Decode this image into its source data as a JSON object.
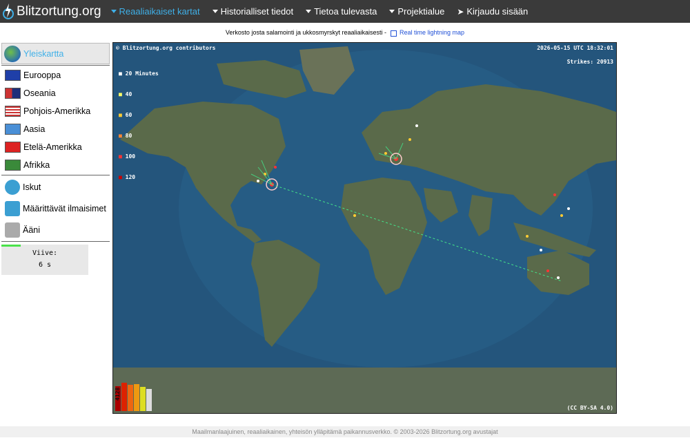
{
  "nav": {
    "brand": "Blitzortung.org",
    "items": [
      {
        "label": "Reaaliaikaiset kartat",
        "active": true,
        "icon": "caret-down"
      },
      {
        "label": "Historialliset tiedot",
        "active": false,
        "icon": "caret-down"
      },
      {
        "label": "Tietoa tulevasta",
        "active": false,
        "icon": "caret-down"
      },
      {
        "label": "Projektialue",
        "active": false,
        "icon": "caret-down"
      },
      {
        "label": "Kirjaudu sisään",
        "active": false,
        "icon": "login-icon"
      }
    ]
  },
  "subtitle": {
    "text": "Verkosto josta salamointi ja ukkosmyrskyt reaaliaikaisesti -",
    "link": "Real time lightning map"
  },
  "sidebar": {
    "selected": "Yleiskartta",
    "regions": [
      "Eurooppa",
      "Oseania",
      "Pohjois-Amerikka",
      "Aasia",
      "Etelä-Amerikka",
      "Afrikka"
    ],
    "tools": [
      "Iskut",
      "Määrittävät ilmaisimet",
      "Ääni"
    ],
    "delay_label": "Viive:",
    "delay_value": "6 s"
  },
  "map": {
    "copyright": "© Blitzortung.org contributors",
    "timestamp": "2026-05-15 UTC 18:32:01",
    "strikes": "Strikes: 20913",
    "legend": [
      "20 Minutes",
      "40",
      "60",
      "80",
      "100",
      "120"
    ],
    "legend_colors": [
      "#ffffff",
      "#ffff66",
      "#ffcc33",
      "#ff8833",
      "#ff3333",
      "#cc0000"
    ],
    "counter": "4128",
    "license": "(CC BY-SA 4.0)"
  },
  "footer": "Maailmanlaajuinen, reaaliaikainen, yhteisön ylläpitämä paikannusverkko. © 2003-2026 Blitzortung.org avustajat"
}
